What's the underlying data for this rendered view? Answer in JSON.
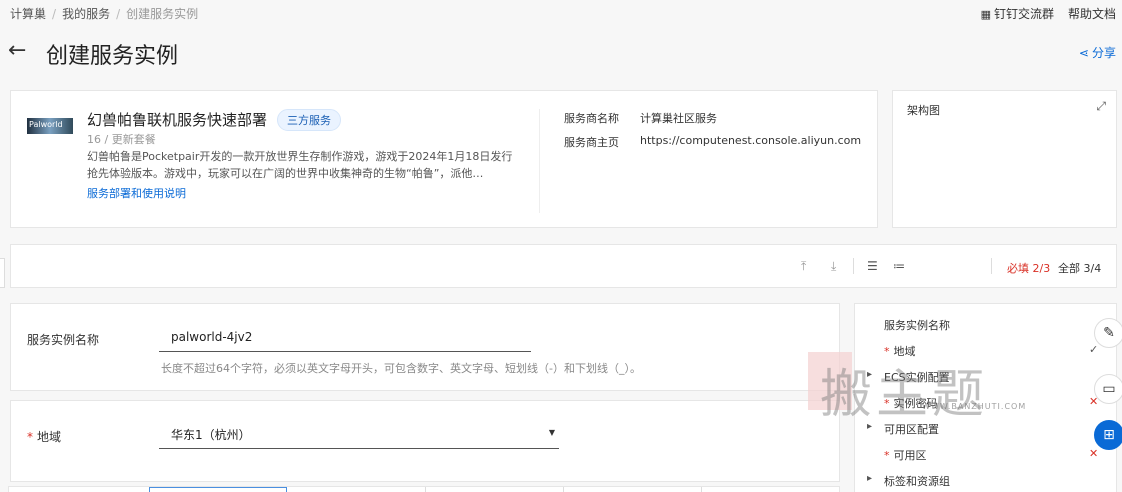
{
  "breadcrumb": {
    "item1": "计算巢",
    "item2": "我的服务",
    "current": "创建服务实例",
    "sep": "/"
  },
  "top_links": {
    "dingtalk": "钉钉交流群",
    "help": "帮助文档"
  },
  "header": {
    "back": "←",
    "title": "创建服务实例",
    "share": "分享"
  },
  "service": {
    "thumb_text": "Palworld",
    "name": "幻兽帕鲁联机服务快速部署",
    "badge": "三方服务",
    "version": "16 / 更新套餐",
    "desc": "幻兽帕鲁是Pocketpair开发的一款开放世界生存制作游戏，游戏于2024年1月18日发行抢先体验版本。游戏中，玩家可以在广阔的世界中收集神奇的生物“帕鲁”，派他…",
    "doc_link": "服务部署和使用说明",
    "provider_label": "服务商名称",
    "provider_value": "计算巢社区服务",
    "homepage_label": "服务商主页",
    "homepage_value": "https://computenest.console.aliyun.com"
  },
  "arch": {
    "title": "架构图"
  },
  "toolbar": {
    "required": "必填 2/3",
    "all": "全部 3/4"
  },
  "form": {
    "instance_name_label": "服务实例名称",
    "instance_name_value": "palworld-4jv2",
    "instance_name_help": "长度不超过64个字符，必须以英文字母开头，可包含数字、英文字母、短划线（-）和下划线（_）。",
    "region_label": "地域",
    "region_value": "华东1（杭州）"
  },
  "nav": {
    "items": [
      "服务实例名称",
      "地域",
      "ECS实例配置",
      "实例密码",
      "可用区配置",
      "可用区",
      "标签和资源组"
    ]
  },
  "watermark": {
    "text": "搬主题",
    "url": "WWW.BANZHUTI.COM"
  },
  "icons": [
    "dingtalk-icon",
    "share-icon",
    "expand-icon",
    "edit-icon",
    "chat-icon",
    "apps-icon"
  ]
}
